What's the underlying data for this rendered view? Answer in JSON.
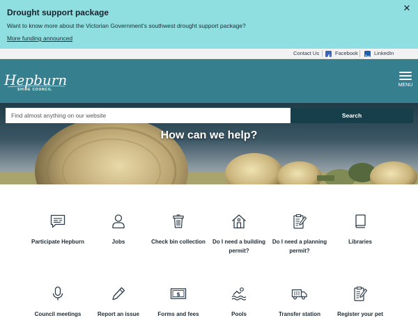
{
  "alert": {
    "title": "Drought support package",
    "text": "Want to know more about the Victorian Government's southwest drought support package?",
    "link": "More funding announced",
    "close": "✕"
  },
  "utility": {
    "contact": "Contact Us",
    "facebook": "Facebook",
    "linkedin": "LinkedIn"
  },
  "header": {
    "logo_text": "Hepburn",
    "logo_sub": "SHIRE COUNCIL",
    "menu_label": "MENU"
  },
  "hero": {
    "search_placeholder": "Find almost anything on our website",
    "search_button": "Search",
    "title": "How can we help?"
  },
  "services": [
    {
      "label": "Participate Hepburn",
      "icon": "speech-bubble-icon"
    },
    {
      "label": "Jobs",
      "icon": "person-icon"
    },
    {
      "label": "Check bin collection",
      "icon": "bin-icon"
    },
    {
      "label": "Do I need a building permit?",
      "icon": "house-icon"
    },
    {
      "label": "Do I need a planning permit?",
      "icon": "clipboard-pencil-icon"
    },
    {
      "label": "Libraries",
      "icon": "book-icon"
    },
    {
      "label": "Council meetings",
      "icon": "microphone-icon"
    },
    {
      "label": "Report an issue",
      "icon": "pencil-icon"
    },
    {
      "label": "Forms and fees",
      "icon": "banknote-icon"
    },
    {
      "label": "Pools",
      "icon": "swimmer-icon"
    },
    {
      "label": "Transfer station",
      "icon": "truck-icon"
    },
    {
      "label": "Register your pet",
      "icon": "clipboard-pencil-icon"
    }
  ],
  "colors": {
    "alert_bg": "#8fdfe0",
    "header_bg": "#357f8e",
    "search_button_bg": "#163e4b",
    "icon_color": "#2b3a48"
  }
}
